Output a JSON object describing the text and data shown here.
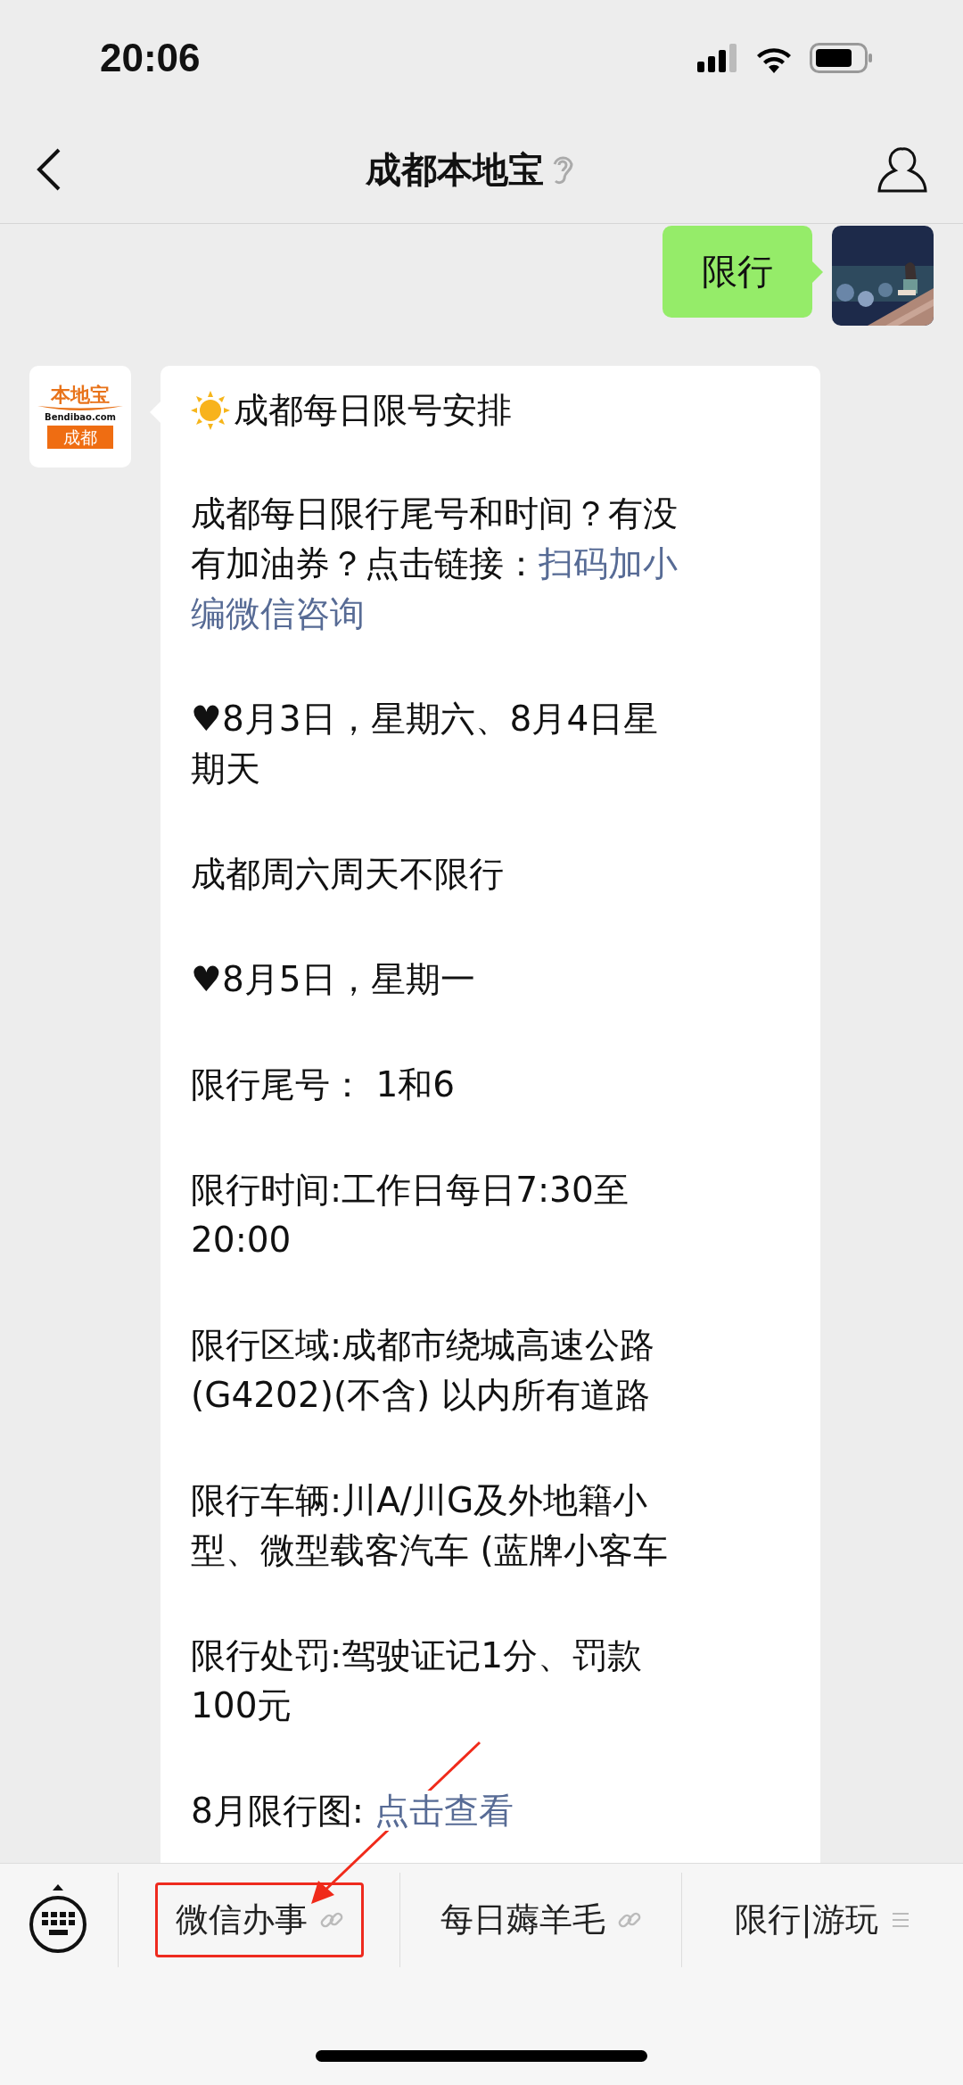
{
  "status_bar": {
    "time": "20:06"
  },
  "nav": {
    "title": "成都本地宝"
  },
  "sent": {
    "text": "限行"
  },
  "received": {
    "logo": {
      "brand": "本地宝",
      "domain": "Bendibao.com",
      "city": "成都"
    },
    "title": "成都每日限号安排",
    "paragraphs": [
      {
        "lines": [
          {
            "text": "成都每日限行尾号和时间？有没"
          },
          {
            "text": "有加油券？点击链接：",
            "link": "扫码加小"
          },
          {
            "link": "编微信咨询"
          }
        ]
      },
      {
        "lines": [
          {
            "text": "♥8月3日，星期六、8月4日星"
          },
          {
            "text": "期天"
          }
        ]
      },
      {
        "lines": [
          {
            "text": "成都周六周天不限行"
          }
        ]
      },
      {
        "lines": [
          {
            "text": "♥8月5日，星期一"
          }
        ]
      },
      {
        "lines": [
          {
            "text": "限行尾号： 1和6"
          }
        ]
      },
      {
        "lines": [
          {
            "text": "限行时间:工作日每日7:30至"
          },
          {
            "text": "20:00"
          }
        ]
      },
      {
        "lines": [
          {
            "text": "限行区域:成都市绕城高速公路"
          },
          {
            "text": "(G4202)(不含) 以内所有道路"
          }
        ]
      },
      {
        "lines": [
          {
            "text": "限行车辆:川A/川G及外地籍小"
          },
          {
            "text": "型、微型载客汽车 (蓝牌小客车"
          }
        ]
      },
      {
        "lines": [
          {
            "text": "限行处罚:驾驶证记1分、罚款"
          },
          {
            "text": "100元"
          }
        ]
      },
      {
        "lines": [
          {
            "text": "8月限行图: ",
            "link": "点击查看"
          }
        ]
      }
    ]
  },
  "menu": [
    {
      "label": "微信办事",
      "kind": "link",
      "highlighted": true
    },
    {
      "label": "每日薅羊毛",
      "kind": "link",
      "highlighted": false
    },
    {
      "label": "限行|游玩",
      "kind": "list",
      "highlighted": false
    }
  ]
}
